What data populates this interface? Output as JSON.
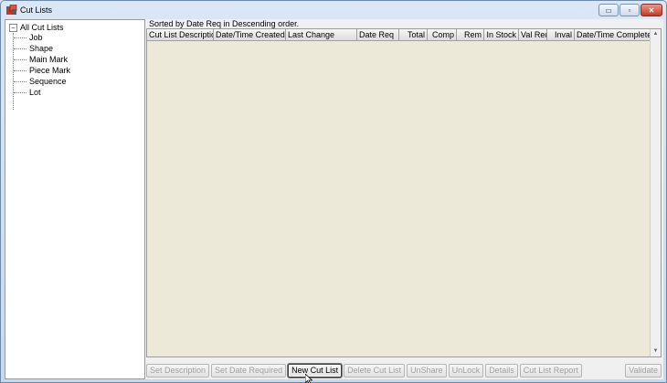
{
  "window": {
    "title": "Cut Lists",
    "controls": {
      "minimize": "▭",
      "maximize": "▫",
      "close": "✕"
    }
  },
  "tree": {
    "root_label": "All Cut Lists",
    "expander": "−",
    "children": [
      "Job",
      "Shape",
      "Main Mark",
      "Piece Mark",
      "Sequence",
      "Lot"
    ]
  },
  "sort_label": "Sorted by Date Req in Descending order.",
  "grid": {
    "columns": [
      "Cut List Description",
      "Date/Time Created",
      "Last Change",
      "Date Req",
      "Total",
      "Comp",
      "Rem",
      "In Stock",
      "Val Req",
      "Inval",
      "Date/Time Completed"
    ],
    "rows": []
  },
  "buttons": {
    "set_description": "Set Description",
    "set_date_required": "Set Date Required",
    "new_cut_list": "New Cut List",
    "delete_cut_list": "Delete Cut List",
    "unshare": "UnShare",
    "unlock": "UnLock",
    "details": "Details",
    "cut_list_report": "Cut List Report",
    "validate": "Validate"
  },
  "colors": {
    "grid_background": "#ece9d8",
    "window_frame": "#c7d9ee",
    "close_button": "#c0392b"
  },
  "icons": {
    "app": "cut-lists-app-icon",
    "scroll_up": "▲",
    "scroll_down": "▼"
  }
}
